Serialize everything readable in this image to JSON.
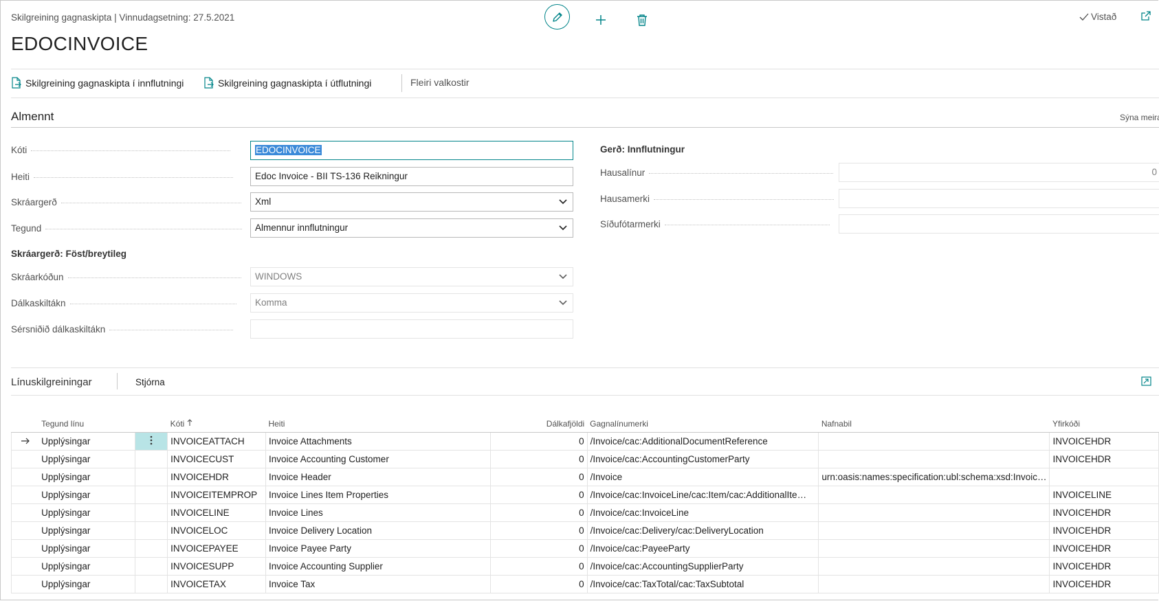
{
  "header": {
    "breadcrumb": "Skilgreining gagnaskipta | Vinnudagsetning: 27.5.2021",
    "title": "EDOCINVOICE",
    "saved_label": "Vistað"
  },
  "actions": {
    "import_label": "Skilgreining gagnaskipta í innflutningi",
    "export_label": "Skilgreining gagnaskipta í útflutningi",
    "more_label": "Fleiri valkostir"
  },
  "general": {
    "section_title": "Almennt",
    "show_more": "Sýna meira",
    "code_label": "Kóti",
    "code_value": "EDOCINVOICE",
    "name_label": "Heiti",
    "name_value": "Edoc Invoice - BII TS-136 Reikningur",
    "filetype_label": "Skráargerð",
    "filetype_value": "Xml",
    "type_label": "Tegund",
    "type_value": "Almennur innflutningur",
    "fixed_title": "Skráargerð: Föst/breytileg",
    "encoding_label": "Skráarkóðun",
    "encoding_value": "WINDOWS",
    "colsep_label": "Dálkaskiltákn",
    "colsep_value": "Komma",
    "custom_colsep_label": "Sérsniðið dálkaskiltákn",
    "custom_colsep_value": "",
    "import_title": "Gerð: Innflutningur",
    "header_lines_label": "Hausalínur",
    "header_lines_value": "0",
    "header_tag_label": "Hausamerki",
    "header_tag_value": "",
    "footer_tag_label": "Síðufótarmerki",
    "footer_tag_value": ""
  },
  "lines": {
    "title": "Línuskilgreiningar",
    "manage_label": "Stjórna",
    "columns": {
      "line_type": "Tegund línu",
      "code": "Kóti",
      "name": "Heiti",
      "col_count": "Dálkafjöldi",
      "data_line_tag": "Gagnalínumerki",
      "namespace": "Nafnabil",
      "parent_code": "Yfirkóði"
    },
    "rows": [
      {
        "type": "Upplýsingar",
        "code": "INVOICEATTACH",
        "name": "Invoice Attachments",
        "count": "0",
        "tag": "/Invoice/cac:AdditionalDocumentReference",
        "ns": "",
        "parent": "INVOICEHDR"
      },
      {
        "type": "Upplýsingar",
        "code": "INVOICECUST",
        "name": "Invoice Accounting Customer",
        "count": "0",
        "tag": "/Invoice/cac:AccountingCustomerParty",
        "ns": "",
        "parent": "INVOICEHDR"
      },
      {
        "type": "Upplýsingar",
        "code": "INVOICEHDR",
        "name": "Invoice Header",
        "count": "0",
        "tag": "/Invoice",
        "ns": "urn:oasis:names:specification:ubl:schema:xsd:Invoic…",
        "parent": ""
      },
      {
        "type": "Upplýsingar",
        "code": "INVOICEITEMPROP",
        "name": "Invoice Lines Item Properties",
        "count": "0",
        "tag": "/Invoice/cac:InvoiceLine/cac:Item/cac:AdditionalIte…",
        "ns": "",
        "parent": "INVOICELINE"
      },
      {
        "type": "Upplýsingar",
        "code": "INVOICELINE",
        "name": "Invoice Lines",
        "count": "0",
        "tag": "/Invoice/cac:InvoiceLine",
        "ns": "",
        "parent": "INVOICEHDR"
      },
      {
        "type": "Upplýsingar",
        "code": "INVOICELOC",
        "name": "Invoice Delivery Location",
        "count": "0",
        "tag": "/Invoice/cac:Delivery/cac:DeliveryLocation",
        "ns": "",
        "parent": "INVOICEHDR"
      },
      {
        "type": "Upplýsingar",
        "code": "INVOICEPAYEE",
        "name": "Invoice Payee Party",
        "count": "0",
        "tag": "/Invoice/cac:PayeeParty",
        "ns": "",
        "parent": "INVOICEHDR"
      },
      {
        "type": "Upplýsingar",
        "code": "INVOICESUPP",
        "name": "Invoice Accounting Supplier",
        "count": "0",
        "tag": "/Invoice/cac:AccountingSupplierParty",
        "ns": "",
        "parent": "INVOICEHDR"
      },
      {
        "type": "Upplýsingar",
        "code": "INVOICETAX",
        "name": "Invoice Tax",
        "count": "0",
        "tag": "/Invoice/cac:TaxTotal/cac:TaxSubtotal",
        "ns": "",
        "parent": "INVOICEHDR"
      }
    ]
  },
  "colors": {
    "accent": "#008489",
    "selection": "#3b8ad9",
    "active_cell": "#b8e4e6"
  }
}
